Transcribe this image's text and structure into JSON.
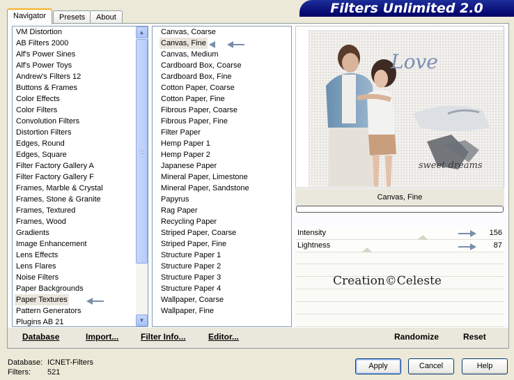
{
  "app": {
    "title": "Filters Unlimited 2.0"
  },
  "tabs": [
    {
      "label": "Navigator",
      "active": true
    },
    {
      "label": "Presets",
      "active": false
    },
    {
      "label": "About",
      "active": false
    }
  ],
  "categories": {
    "items": [
      "VM Distortion",
      "AB Filters 2000",
      "Alf's Power Sines",
      "Alf's Power Toys",
      "Andrew's Filters 12",
      "Buttons & Frames",
      "Color Effects",
      "Color Filters",
      "Convolution Filters",
      "Distortion Filters",
      "Edges, Round",
      "Edges, Square",
      "Filter Factory Gallery A",
      "Filter Factory Gallery F",
      "Frames, Marble & Crystal",
      "Frames, Stone & Granite",
      "Frames, Textured",
      "Frames, Wood",
      "Gradients",
      "Image Enhancement",
      "Lens Effects",
      "Lens Flares",
      "Noise Filters",
      "Paper Backgrounds",
      "Paper Textures",
      "Pattern Generators",
      "Plugins AB 21"
    ],
    "selected": "Paper Textures"
  },
  "filters": {
    "items": [
      "Canvas, Coarse",
      "Canvas, Fine",
      "Canvas, Medium",
      "Cardboard Box, Coarse",
      "Cardboard Box, Fine",
      "Cotton Paper, Coarse",
      "Cotton Paper, Fine",
      "Fibrous Paper, Coarse",
      "Fibrous Paper, Fine",
      "Filter Paper",
      "Hemp Paper 1",
      "Hemp Paper 2",
      "Japanese Paper",
      "Mineral Paper, Limestone",
      "Mineral Paper, Sandstone",
      "Papyrus",
      "Rag Paper",
      "Recycling Paper",
      "Striped Paper, Coarse",
      "Striped Paper, Fine",
      "Structure Paper 1",
      "Structure Paper 2",
      "Structure Paper 3",
      "Structure Paper 4",
      "Wallpaper, Coarse",
      "Wallpaper, Fine"
    ],
    "selected": "Canvas, Fine"
  },
  "preview": {
    "filter_name": "Canvas, Fine",
    "image_texts": {
      "love": "Love",
      "sweet_dreams": "sweet dreams"
    }
  },
  "parameters": [
    {
      "label": "Intensity",
      "value": "156"
    },
    {
      "label": "Lightness",
      "value": "87"
    }
  ],
  "watermark": "Creation©Celeste",
  "buttons": {
    "database": "Database",
    "import": "Import...",
    "filter_info": "Filter Info...",
    "editor": "Editor...",
    "randomize": "Randomize",
    "reset": "Reset",
    "apply": "Apply",
    "cancel": "Cancel",
    "help": "Help"
  },
  "footer": {
    "database_label": "Database:",
    "database_value": "ICNET-Filters",
    "filters_label": "Filters:",
    "filters_value": "521"
  },
  "colors": {
    "title_bar": "#000066",
    "selection": "#eae6dc",
    "arrow": "#7a8ea8",
    "dialog_bg": "#ece9d8"
  }
}
